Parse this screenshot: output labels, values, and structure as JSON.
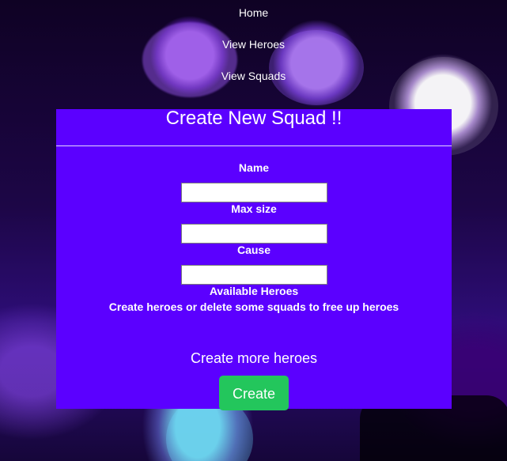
{
  "nav": {
    "items": [
      {
        "label": "Home"
      },
      {
        "label": "View Heroes"
      },
      {
        "label": "View Squads"
      }
    ]
  },
  "form": {
    "title": "Create New Squad !!",
    "fields": [
      {
        "label": "Name",
        "value": "",
        "placeholder": ""
      },
      {
        "label": "Max size",
        "value": "",
        "placeholder": ""
      },
      {
        "label": "Cause",
        "value": "",
        "placeholder": ""
      }
    ],
    "available_heroes_label": "Available Heroes",
    "empty_message": "Create heroes or delete some squads to free up heroes",
    "more_link_label": "Create more heroes",
    "submit_label": "Create"
  },
  "colors": {
    "card_background": "#5b00ff",
    "button_background": "#23c65c",
    "text": "#ffffff"
  },
  "icons": []
}
